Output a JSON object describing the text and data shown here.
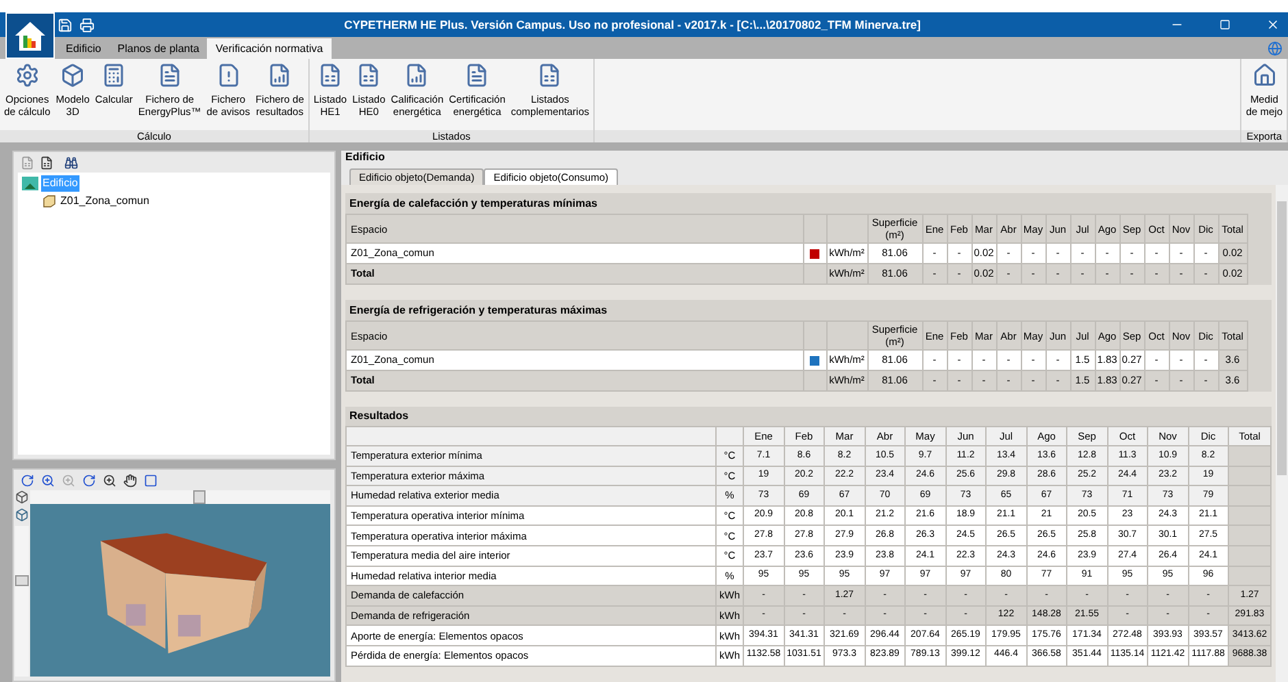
{
  "window": {
    "title": "CYPETHERM HE Plus. Versión Campus. Uso no profesional - v2017.k - [C:\\...\\20170802_TFM Minerva.tre]"
  },
  "ribbon_tabs": [
    {
      "label": "Edificio",
      "selected": false
    },
    {
      "label": "Planos de planta",
      "selected": false
    },
    {
      "label": "Verificación normativa",
      "selected": true
    }
  ],
  "ribbon_groups": [
    {
      "label": "Cálculo",
      "buttons": [
        [
          "Opciones",
          "de cálculo"
        ],
        [
          "Modelo",
          "3D"
        ],
        [
          "Calcular"
        ],
        [
          "Fichero de",
          "EnergyPlus™"
        ],
        [
          "Fichero",
          "de avisos"
        ],
        [
          "Fichero de",
          "resultados"
        ]
      ]
    },
    {
      "label": "Listados",
      "buttons": [
        [
          "Listado",
          "HE1"
        ],
        [
          "Listado",
          "HE0"
        ],
        [
          "Calificación",
          "energética"
        ],
        [
          "Certificación",
          "energética"
        ],
        [
          "Listados",
          "complementarios"
        ]
      ]
    },
    {
      "label": "Exporta",
      "buttons": [
        [
          "Medid",
          "de mejo"
        ]
      ]
    }
  ],
  "viewer": {
    "horizontal_slider": {
      "level": 0.56
    }
  },
  "tree": [
    {
      "label": "Edificio",
      "selected": true,
      "children": [
        {
          "label": "Z01_Zona_comun",
          "selected": false
        }
      ]
    }
  ],
  "panel": {
    "title": "Edificio",
    "tabs": [
      {
        "label": "Edificio objeto(Demanda)",
        "selected": true
      },
      {
        "label": "Edificio objeto(Consumo)",
        "selected": false
      }
    ],
    "zone_tables": [
      {
        "title": "Energía de calefacción y temperaturas mínimas",
        "columns": [
          "Espacio",
          "",
          "",
          "Superficie (m²)",
          "Ene",
          "Feb",
          "Mar",
          "Abr",
          "May",
          "Jun",
          "Jul",
          "Ago",
          "Sep",
          "Oct",
          "Nov",
          "Dic",
          "Total"
        ],
        "rows": [
          {
            "color": "#c00000",
            "cells": [
              "Z01_Zona_comun",
              "",
              "kWh/m²",
              "81.06",
              "-",
              "-",
              "0.02",
              "-",
              "-",
              "-",
              "-",
              "-",
              "-",
              "-",
              "-",
              "-",
              "0.02"
            ]
          }
        ],
        "total": {
          "cells": [
            "Total",
            "",
            "kWh/m²",
            "81.06",
            "-",
            "-",
            "0.02",
            "-",
            "-",
            "-",
            "-",
            "-",
            "-",
            "-",
            "-",
            "-",
            "0.02"
          ]
        }
      },
      {
        "title": "Energía de refrigeración y temperaturas máximas",
        "columns": [
          "Espacio",
          "",
          "",
          "Superficie (m²)",
          "Ene",
          "Feb",
          "Mar",
          "Abr",
          "May",
          "Jun",
          "Jul",
          "Ago",
          "Sep",
          "Oct",
          "Nov",
          "Dic",
          "Total"
        ],
        "rows": [
          {
            "color": "#1e73be",
            "cells": [
              "Z01_Zona_comun",
              "",
              "kWh/m²",
              "81.06",
              "-",
              "-",
              "-",
              "-",
              "-",
              "-",
              "1.5",
              "1.83",
              "0.27",
              "-",
              "-",
              "-",
              "3.6"
            ]
          }
        ],
        "total": {
          "cells": [
            "Total",
            "",
            "kWh/m²",
            "81.06",
            "-",
            "-",
            "-",
            "-",
            "-",
            "-",
            "1.5",
            "1.83",
            "0.27",
            "-",
            "-",
            "-",
            "3.6"
          ]
        }
      }
    ],
    "results": {
      "title": "Resultados",
      "columns": [
        "Ene",
        "Feb",
        "Mar",
        "Abr",
        "May",
        "Jun",
        "Jul",
        "Ago",
        "Sep",
        "Oct",
        "Nov",
        "Dic",
        "Total"
      ],
      "rows": [
        {
          "kind": "exterior",
          "label": "Temperatura exterior mínima",
          "unit": "°C",
          "cells": [
            "7.1",
            "8.6",
            "8.2",
            "10.5",
            "9.7",
            "11.2",
            "13.4",
            "13.6",
            "12.8",
            "11.3",
            "10.9",
            "8.2",
            ""
          ]
        },
        {
          "kind": "exterior",
          "label": "Temperatura exterior máxima",
          "unit": "°C",
          "cells": [
            "19",
            "20.2",
            "22.2",
            "23.4",
            "24.6",
            "25.6",
            "29.8",
            "28.6",
            "25.2",
            "24.4",
            "23.2",
            "19",
            ""
          ]
        },
        {
          "kind": "exterior",
          "label": "Humedad relativa exterior media",
          "unit": "%",
          "cells": [
            "73",
            "69",
            "67",
            "70",
            "69",
            "73",
            "65",
            "67",
            "73",
            "71",
            "73",
            "79",
            ""
          ]
        },
        {
          "kind": "interior",
          "label": "Temperatura operativa interior mínima",
          "unit": "°C",
          "cells": [
            "20.9",
            "20.8",
            "20.1",
            "21.2",
            "21.6",
            "18.9",
            "21.1",
            "21",
            "20.5",
            "23",
            "24.3",
            "21.1",
            ""
          ]
        },
        {
          "kind": "interior",
          "label": "Temperatura operativa interior máxima",
          "unit": "°C",
          "cells": [
            "27.8",
            "27.8",
            "27.9",
            "26.8",
            "26.3",
            "24.5",
            "26.5",
            "26.5",
            "25.8",
            "30.7",
            "30.1",
            "27.5",
            ""
          ]
        },
        {
          "kind": "interior",
          "label": "Temperatura media del aire interior",
          "unit": "°C",
          "cells": [
            "23.7",
            "23.6",
            "23.9",
            "23.8",
            "24.1",
            "22.3",
            "24.3",
            "24.6",
            "23.9",
            "27.4",
            "26.4",
            "24.1",
            ""
          ]
        },
        {
          "kind": "interior",
          "label": "Humedad relativa interior media",
          "unit": "%",
          "cells": [
            "95",
            "95",
            "95",
            "97",
            "97",
            "97",
            "80",
            "77",
            "91",
            "95",
            "95",
            "96",
            ""
          ]
        },
        {
          "kind": "demand",
          "label": "Demanda de calefacción",
          "unit": "kWh",
          "cells": [
            "-",
            "-",
            "1.27",
            "-",
            "-",
            "-",
            "-",
            "-",
            "-",
            "-",
            "-",
            "-",
            "1.27"
          ]
        },
        {
          "kind": "demand",
          "label": "Demanda de refrigeración",
          "unit": "kWh",
          "cells": [
            "-",
            "-",
            "-",
            "-",
            "-",
            "-",
            "122",
            "148.28",
            "21.55",
            "-",
            "-",
            "-",
            "291.83"
          ]
        },
        {
          "kind": "energy",
          "label": "Aporte de energía: Elementos opacos",
          "unit": "kWh",
          "cells": [
            "394.31",
            "341.31",
            "321.69",
            "296.44",
            "207.64",
            "265.19",
            "179.95",
            "175.76",
            "171.34",
            "272.48",
            "393.93",
            "393.57",
            "3413.62"
          ]
        },
        {
          "kind": "energy",
          "label": "Pérdida de energía: Elementos opacos",
          "unit": "kWh",
          "cells": [
            "1132.58",
            "1031.51",
            "973.3",
            "823.89",
            "789.13",
            "399.12",
            "446.4",
            "366.58",
            "351.44",
            "1135.14",
            "1121.42",
            "1117.88",
            "9688.38"
          ]
        }
      ]
    }
  }
}
